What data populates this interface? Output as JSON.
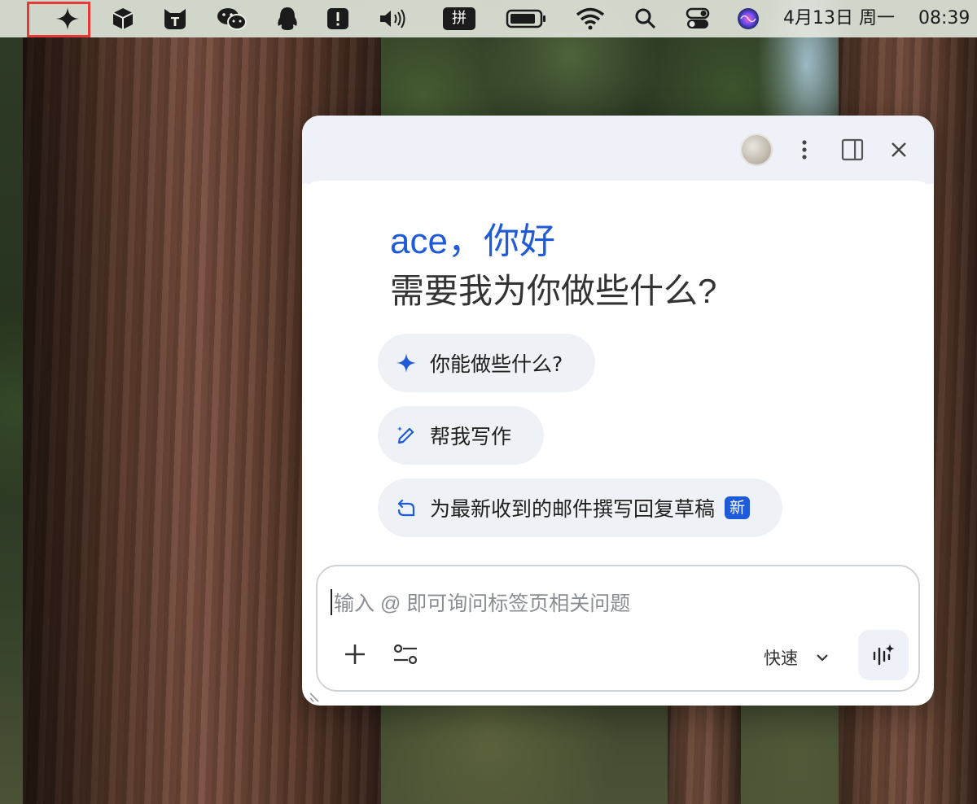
{
  "menubar": {
    "icons": [
      "sparkle-icon",
      "box-icon",
      "cat-t-icon",
      "wechat-icon",
      "qq-penguin-icon",
      "alert-icon",
      "volume-icon",
      "ime-pinyin",
      "battery-icon",
      "wifi-icon",
      "search-icon",
      "control-center-icon",
      "siri-icon"
    ],
    "ime_label": "拼",
    "date": "4月13日 周一",
    "time": "08:39",
    "highlight_color": "#e53935"
  },
  "panel": {
    "greeting_name": "ace，你好",
    "greeting_question": "需要我为你做些什么?",
    "suggestions": [
      {
        "label": "你能做些什么?",
        "icon": "sparkle-icon"
      },
      {
        "label": "帮我写作",
        "icon": "pen-sparkle-icon"
      },
      {
        "label": "为最新收到的邮件撰写回复草稿",
        "icon": "reply-icon",
        "badge": "新"
      }
    ],
    "input": {
      "placeholder": "输入 @ 即可询问标签页相关问题",
      "value": ""
    },
    "mode": {
      "selected": "快速"
    },
    "header_buttons": [
      "avatar",
      "more-options-icon",
      "sidebar-toggle-icon",
      "close-icon"
    ],
    "colors": {
      "accent": "#1f5bd8",
      "chip_bg": "#eef1f6",
      "header_bg": "#eef2f8"
    }
  }
}
